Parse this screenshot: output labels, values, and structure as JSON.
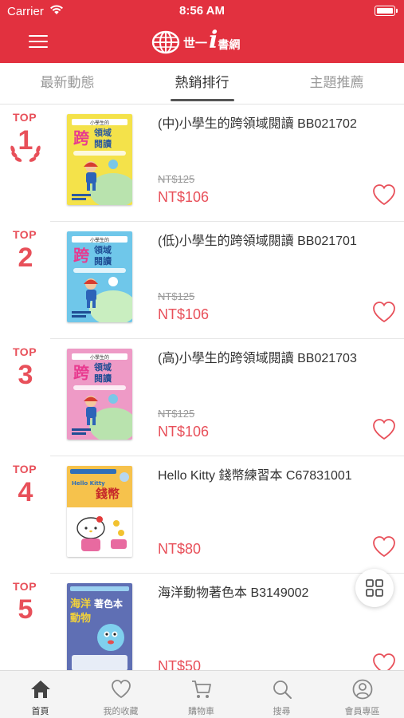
{
  "status_bar": {
    "carrier": "Carrier",
    "time": "8:56 AM"
  },
  "header": {
    "logo_text": "世一",
    "logo_i": "i",
    "logo_text2": "書網"
  },
  "tabs": [
    {
      "label": "最新動態",
      "active": false
    },
    {
      "label": "熱銷排行",
      "active": true
    },
    {
      "label": "主題推薦",
      "active": false
    }
  ],
  "rank_prefix": "TOP",
  "books": [
    {
      "rank": "1",
      "title": "(中)小學生的跨領域閱讀 BB021702",
      "orig_price": "NT$125",
      "price": "NT$106",
      "cover_color": "#f4e24a"
    },
    {
      "rank": "2",
      "title": "(低)小學生的跨領域閱讀 BB021701",
      "orig_price": "NT$125",
      "price": "NT$106",
      "cover_color": "#6fc7ea"
    },
    {
      "rank": "3",
      "title": "(高)小學生的跨領域閱讀 BB021703",
      "orig_price": "NT$125",
      "price": "NT$106",
      "cover_color": "#ee9ac6"
    },
    {
      "rank": "4",
      "title": "Hello Kitty 錢幣練習本 C67831001",
      "orig_price": "",
      "price": "NT$80",
      "cover_color": "#f6c24c"
    },
    {
      "rank": "5",
      "title": "海洋動物著色本 B3149002",
      "orig_price": "",
      "price": "NT$50",
      "cover_color": "#5f6fb4"
    }
  ],
  "cover_text": {
    "series": "小學生的",
    "main": "跨",
    "sub": "領域",
    "sub2": "閱讀",
    "kitty_title": "錢幣",
    "kitty_brand": "Hello Kitty",
    "ocean_title1": "海洋",
    "ocean_title2": "著色本",
    "ocean_title3": "動物"
  },
  "bottom_nav": [
    {
      "label": "首頁",
      "icon": "home-icon",
      "active": true
    },
    {
      "label": "我的收藏",
      "icon": "heart-icon",
      "active": false
    },
    {
      "label": "購物車",
      "icon": "cart-icon",
      "active": false
    },
    {
      "label": "搜尋",
      "icon": "search-icon",
      "active": false
    },
    {
      "label": "會員專區",
      "icon": "user-icon",
      "active": false
    }
  ],
  "colors": {
    "brand": "#e2313f",
    "accent": "#e8505a"
  }
}
